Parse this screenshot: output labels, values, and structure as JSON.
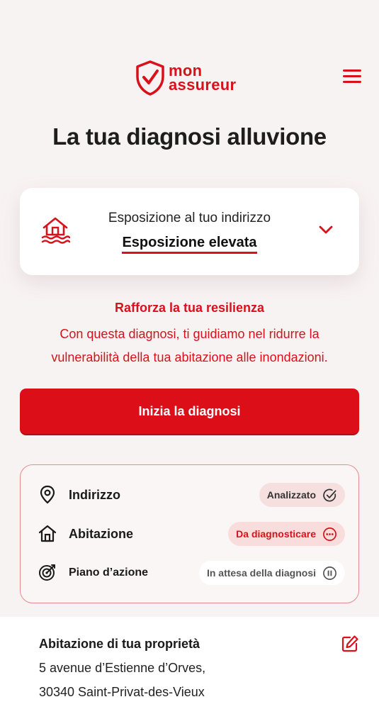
{
  "brand": {
    "line1": "mon",
    "line2": "assureur",
    "color": "#d8111a"
  },
  "header": {
    "menu_icon": "hamburger-menu-icon"
  },
  "page": {
    "title": "La tua diagnosi alluvione"
  },
  "exposure": {
    "label": "Esposizione al tuo indirizzo",
    "value": "Esposizione elevata",
    "icon": "flooded-house-icon"
  },
  "resilience": {
    "title": "Rafforza la tua resilienza",
    "text": "Con questa diagnosi, ti guidiamo nel ridurre la vulnerabilità della tua abitazione alle inondazioni."
  },
  "cta": {
    "label": "Inizia la diagnosi"
  },
  "status": {
    "items": [
      {
        "label": "Indirizzo",
        "icon": "location-pin-icon",
        "badge": "Analizzato",
        "badge_icon": "check-circle-icon"
      },
      {
        "label": "Abitazione",
        "icon": "house-icon",
        "badge": "Da diagnosticare",
        "badge_icon": "more-circle-icon"
      },
      {
        "label": "Piano d’azione",
        "icon": "target-icon",
        "badge": "In attesa della diagnosi",
        "badge_icon": "pause-circle-icon"
      }
    ]
  },
  "property": {
    "title": "Abitazione di tua proprietà",
    "address_line1": "5 avenue d’Estienne d’Orves,",
    "address_line2": "30340 Saint-Privat-des-Vieux"
  }
}
